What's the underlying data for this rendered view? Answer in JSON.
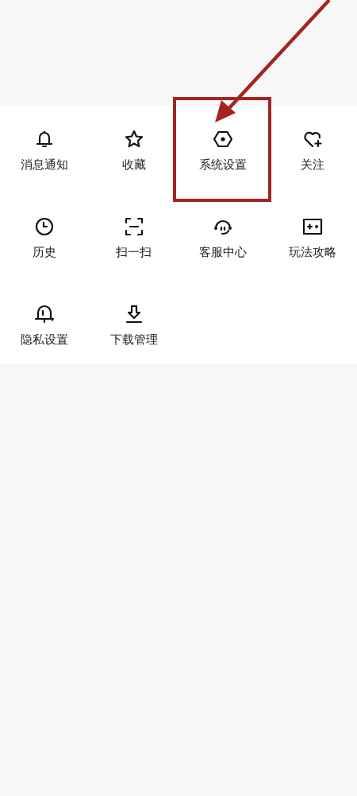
{
  "menu_items": [
    {
      "label": "消息通知",
      "kind": "bell",
      "highlighted": false
    },
    {
      "label": "收藏",
      "kind": "star",
      "highlighted": false
    },
    {
      "label": "系统设置",
      "kind": "settings",
      "highlighted": true
    },
    {
      "label": "关注",
      "kind": "heart-plus",
      "highlighted": false
    },
    {
      "label": "历史",
      "kind": "clock",
      "highlighted": false
    },
    {
      "label": "扫一扫",
      "kind": "scan",
      "highlighted": false
    },
    {
      "label": "客服中心",
      "kind": "headset",
      "highlighted": false
    },
    {
      "label": "玩法攻略",
      "kind": "game",
      "highlighted": false
    },
    {
      "label": "隐私设置",
      "kind": "privacy",
      "highlighted": false
    },
    {
      "label": "下载管理",
      "kind": "download",
      "highlighted": false
    }
  ]
}
